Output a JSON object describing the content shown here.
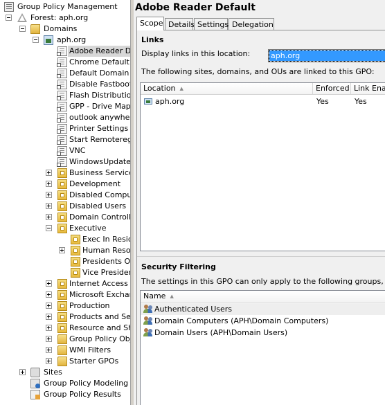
{
  "tree": {
    "root": "Group Policy Management",
    "forest": "Forest: aph.org",
    "domains": "Domains",
    "domain": "aph.org",
    "gpo_links": [
      "Adobe Reader Default",
      "Chrome Default",
      "Default Domain Policy",
      "Disable Fastboot",
      "Flash Distribution",
      "GPP - Drive Maps",
      "outlook anywhere",
      "Printer Settings",
      "Start Remoteregistry",
      "VNC",
      "WindowsUpdate"
    ],
    "ous": [
      "Business Services",
      "Development",
      "Disabled Computers",
      "Disabled Users",
      "Domain Controllers",
      "Executive"
    ],
    "executive_children": [
      "Exec In Residence",
      "Human Resources",
      "Presidents Office",
      "Vice Presidents"
    ],
    "ous_after": [
      "Internet Access Groups",
      "Microsoft Exchange",
      "Production",
      "Products and Services",
      "Resource and Sharing"
    ],
    "containers": [
      "Group Policy Objects",
      "WMI Filters",
      "Starter GPOs"
    ],
    "sites": "Sites",
    "modeling": "Group Policy Modeling",
    "results": "Group Policy Results"
  },
  "detail": {
    "title": "Adobe Reader Default",
    "tabs": [
      "Scope",
      "Details",
      "Settings",
      "Delegation"
    ],
    "active_tab": "Scope",
    "links": {
      "heading": "Links",
      "display_label": "Display links in this location:",
      "location_value": "aph.org",
      "description": "The following sites, domains, and OUs are linked to this GPO:",
      "columns": [
        "Location",
        "Enforced",
        "Link Enabled"
      ],
      "rows": [
        {
          "location": "aph.org",
          "enforced": "Yes",
          "link_enabled": "Yes"
        }
      ]
    },
    "security": {
      "heading": "Security Filtering",
      "description": "The settings in this GPO can only apply to the following groups, users, and computers:",
      "column": "Name",
      "rows": [
        "Authenticated Users",
        "Domain Computers (APH\\Domain Computers)",
        "Domain Users (APH\\Domain Users)"
      ]
    }
  }
}
